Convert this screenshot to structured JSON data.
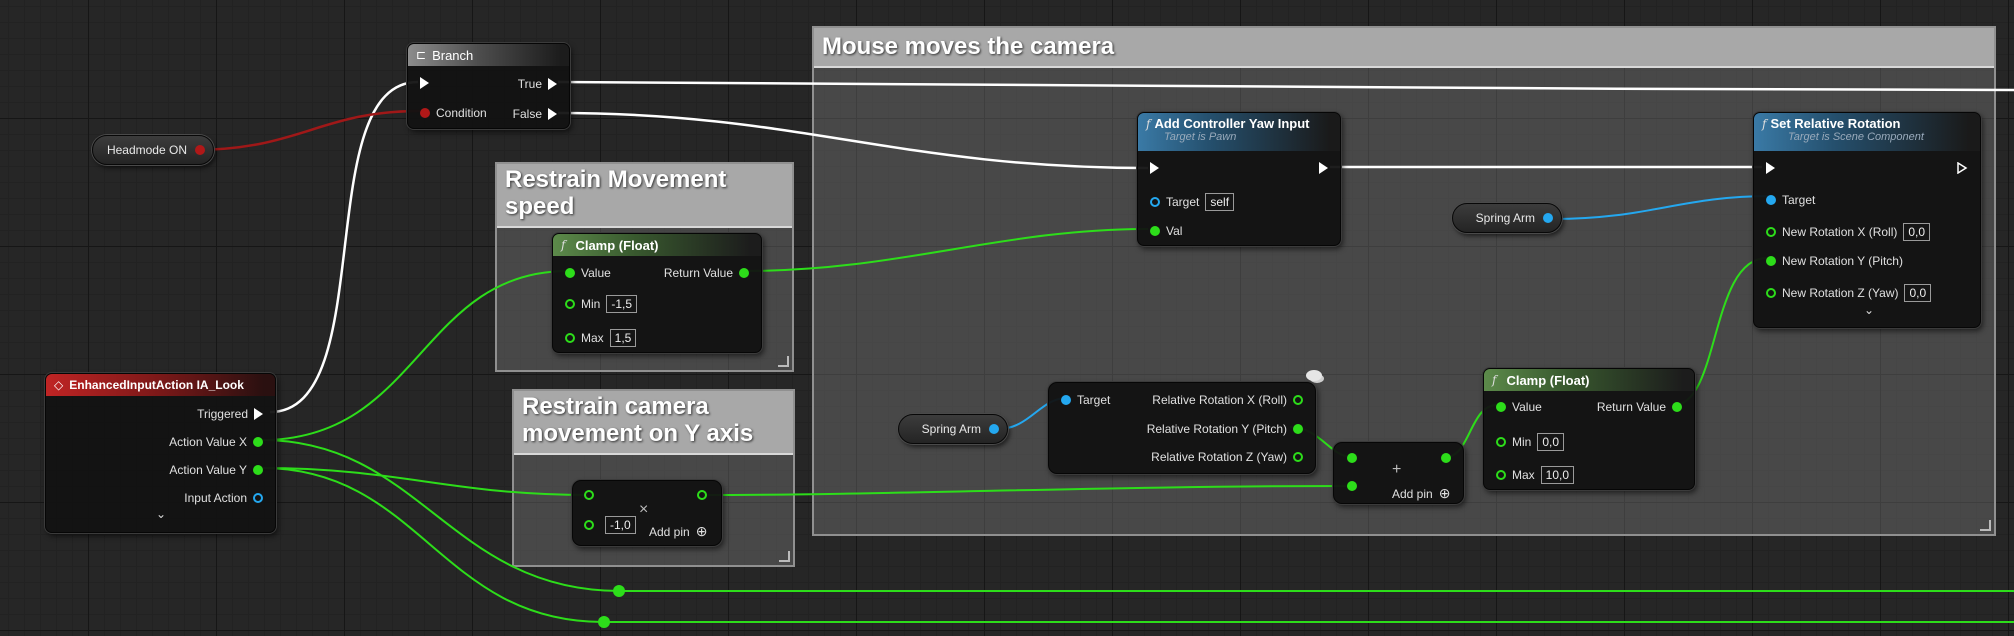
{
  "colors": {
    "exec": "#ffffff",
    "float": "#2ddd1a",
    "object": "#24a8f0",
    "bool": "#b01818"
  },
  "comments": {
    "mouse": {
      "title": "Mouse moves the camera"
    },
    "speed": {
      "title": "Restrain Movement speed"
    },
    "yaxis": {
      "title": "Restrain camera movement on Y axis"
    }
  },
  "branch": {
    "title": "Branch",
    "icon": "branch-icon",
    "condition": "Condition",
    "true": "True",
    "false": "False"
  },
  "headmode": {
    "label": "Headmode ON"
  },
  "input_action": {
    "title": "EnhancedInputAction IA_Look",
    "icon": "diamond-icon",
    "triggered": "Triggered",
    "action_x": "Action Value X",
    "action_y": "Action Value Y",
    "input_action": "Input Action",
    "expand": "⌄"
  },
  "clamp1": {
    "title": "Clamp (Float)",
    "value": "Value",
    "return": "Return Value",
    "min_label": "Min",
    "min": "-1,5",
    "max_label": "Max",
    "max": "1,5"
  },
  "multiply": {
    "a": "-1,0",
    "add_pin": "Add pin"
  },
  "yaw": {
    "title": "Add Controller Yaw Input",
    "subtitle": "Target is Pawn",
    "target": "Target",
    "self": "self",
    "val": "Val"
  },
  "spring_arm_1": {
    "label": "Spring Arm"
  },
  "spring_arm_2": {
    "label": "Spring Arm"
  },
  "break_rot": {
    "target": "Target",
    "x": "Relative Rotation X (Roll)",
    "y": "Relative Rotation Y (Pitch)",
    "z": "Relative Rotation Z (Yaw)"
  },
  "add": {
    "add_pin": "Add pin"
  },
  "clamp2": {
    "title": "Clamp (Float)",
    "value": "Value",
    "return": "Return Value",
    "min_label": "Min",
    "min": "0,0",
    "max_label": "Max",
    "max": "10,0"
  },
  "set_rot": {
    "title": "Set Relative Rotation",
    "subtitle": "Target is Scene Component",
    "target": "Target",
    "x": "New Rotation X (Roll)",
    "x_val": "0,0",
    "y": "New Rotation Y (Pitch)",
    "z": "New Rotation Z (Yaw)",
    "z_val": "0,0",
    "expand": "⌄"
  }
}
